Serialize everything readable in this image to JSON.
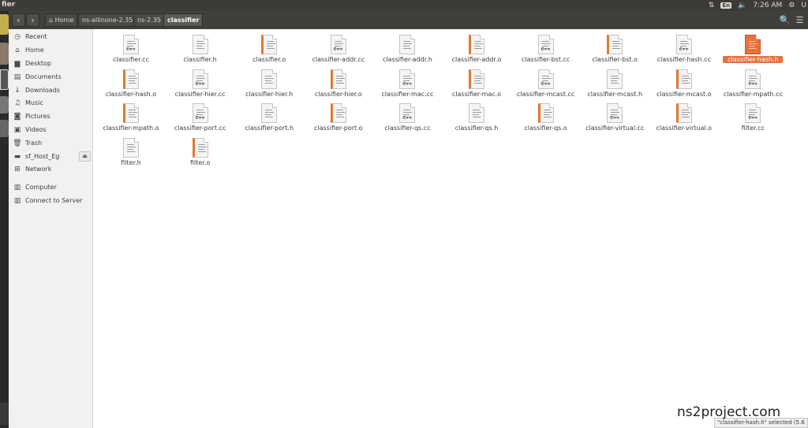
{
  "window": {
    "title": "fier"
  },
  "tray": {
    "lang": "En",
    "time": "7:26 AM",
    "user": "U"
  },
  "breadcrumbs": [
    {
      "label": "Home"
    },
    {
      "label": "ns-allinone-2.35"
    },
    {
      "label": "ns-2.35"
    },
    {
      "label": "classifier"
    }
  ],
  "sidebar": {
    "items": [
      {
        "label": "Recent",
        "icon": "clock-icon"
      },
      {
        "label": "Home",
        "icon": "home-icon"
      },
      {
        "label": "Desktop",
        "icon": "desktop-icon"
      },
      {
        "label": "Documents",
        "icon": "documents-icon"
      },
      {
        "label": "Downloads",
        "icon": "download-icon"
      },
      {
        "label": "Music",
        "icon": "music-icon"
      },
      {
        "label": "Pictures",
        "icon": "camera-icon"
      },
      {
        "label": "Videos",
        "icon": "video-icon"
      },
      {
        "label": "Trash",
        "icon": "trash-icon"
      },
      {
        "label": "sf_Host_Eg",
        "icon": "drive-icon"
      },
      {
        "label": "Network",
        "icon": "network-icon"
      },
      {
        "label": "Computer",
        "icon": "computer-icon"
      },
      {
        "label": "Connect to Server",
        "icon": "server-icon"
      }
    ]
  },
  "files": [
    {
      "name": "classifier.cc",
      "kind": "cc"
    },
    {
      "name": "classifier.h",
      "kind": "h"
    },
    {
      "name": "classifier.o",
      "kind": "o"
    },
    {
      "name": "classifier-addr.cc",
      "kind": "cc"
    },
    {
      "name": "classifier-addr.h",
      "kind": "h"
    },
    {
      "name": "classifier-addr.o",
      "kind": "o"
    },
    {
      "name": "classifier-bst.cc",
      "kind": "cc"
    },
    {
      "name": "classifier-bst.o",
      "kind": "o"
    },
    {
      "name": "classifier-hash.cc",
      "kind": "cc"
    },
    {
      "name": "classifier-hash.h",
      "kind": "h",
      "selected": true
    },
    {
      "name": "classifier-hash.o",
      "kind": "o"
    },
    {
      "name": "classifier-hier.cc",
      "kind": "cc"
    },
    {
      "name": "classifier-hier.h",
      "kind": "h"
    },
    {
      "name": "classifier-hier.o",
      "kind": "o"
    },
    {
      "name": "classifier-mac.cc",
      "kind": "cc"
    },
    {
      "name": "classifier-mac.o",
      "kind": "o"
    },
    {
      "name": "classifier-mcast.cc",
      "kind": "cc"
    },
    {
      "name": "classifier-mcast.h",
      "kind": "h"
    },
    {
      "name": "classifier-mcast.o",
      "kind": "o"
    },
    {
      "name": "classifier-mpath.cc",
      "kind": "cc"
    },
    {
      "name": "classifier-mpath.o",
      "kind": "o"
    },
    {
      "name": "classifier-port.cc",
      "kind": "cc"
    },
    {
      "name": "classifier-port.h",
      "kind": "h"
    },
    {
      "name": "classifier-port.o",
      "kind": "o"
    },
    {
      "name": "classifier-qs.cc",
      "kind": "cc"
    },
    {
      "name": "classifier-qs.h",
      "kind": "h"
    },
    {
      "name": "classifier-qs.o",
      "kind": "o"
    },
    {
      "name": "classifier-virtual.cc",
      "kind": "cc"
    },
    {
      "name": "classifier-virtual.o",
      "kind": "o"
    },
    {
      "name": "filter.cc",
      "kind": "cc"
    },
    {
      "name": "filter.h",
      "kind": "h"
    },
    {
      "name": "filter.o",
      "kind": "o"
    }
  ],
  "status": {
    "text": "\"classifier-hash.h\" selected  (5.6"
  },
  "watermark": {
    "text": "ns2project.com"
  },
  "colors": {
    "accent": "#e8703a",
    "panel": "#3c3b37",
    "launcher": "#2b2929"
  }
}
